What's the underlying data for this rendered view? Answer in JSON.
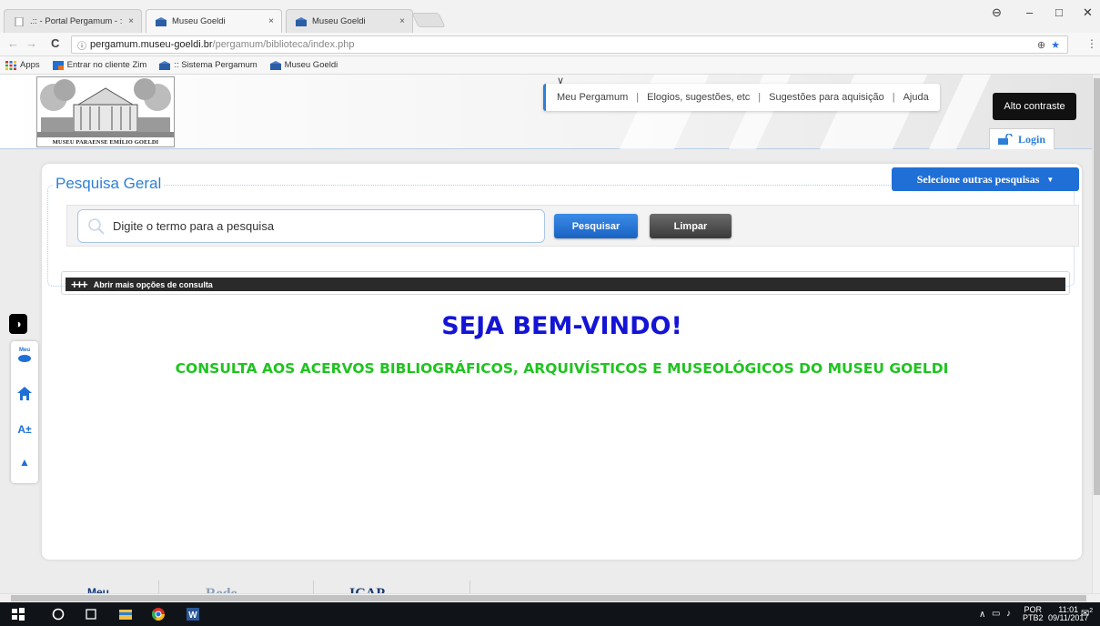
{
  "browser": {
    "tabs": [
      {
        "title": ".:: - Portal Pergamum - ::",
        "active": false
      },
      {
        "title": "Museu Goeldi",
        "active": true
      },
      {
        "title": "Museu Goeldi",
        "active": false
      }
    ],
    "tab_close": "×",
    "url_host": "pergamum.museu-goeldi.br",
    "url_path": "/pergamum/biblioteca/index.php",
    "bookmarks": [
      {
        "label": "Apps"
      },
      {
        "label": "Entrar no cliente Zim"
      },
      {
        "label": ":: Sistema Pergamum"
      },
      {
        "label": "Museu Goeldi"
      }
    ]
  },
  "header": {
    "logo_caption": "MUSEU PARAENSE EMÍLIO GOELDI",
    "menu": [
      "Meu Pergamum",
      "Elogios, sugestões, etc",
      "Sugestões para aquisição",
      "Ajuda"
    ],
    "menu_separator": "|",
    "contrast_label": "Alto contraste",
    "login_label": "Login"
  },
  "search": {
    "title": "Pesquisa Geral",
    "other_searches_label": "Selecione outras pesquisas",
    "placeholder": "Digite o termo para a pesquisa",
    "search_button": "Pesquisar",
    "clear_button": "Limpar",
    "more_options_label": "Abrir mais opções de consulta"
  },
  "main": {
    "welcome": "SEJA BEM-VINDO!",
    "subtitle": "CONSULTA AOS ACERVOS BIBLIOGRÁFICOS, ARQUIVÍSTICOS E MUSEOLÓGICOS DO MUSEU GOELDI"
  },
  "sidebar": {
    "meu_label": "Meu"
  },
  "footer": {
    "items": [
      "Meu",
      "Rede",
      "ICAP"
    ]
  },
  "taskbar": {
    "language_top": "POR",
    "language_bottom": "PTB2",
    "time": "11:01",
    "date": "09/11/2017",
    "notification_count": "2"
  },
  "colors": {
    "accent": "#2e7fd8",
    "welcome": "#1414d6",
    "subtitle": "#1fc41f"
  }
}
